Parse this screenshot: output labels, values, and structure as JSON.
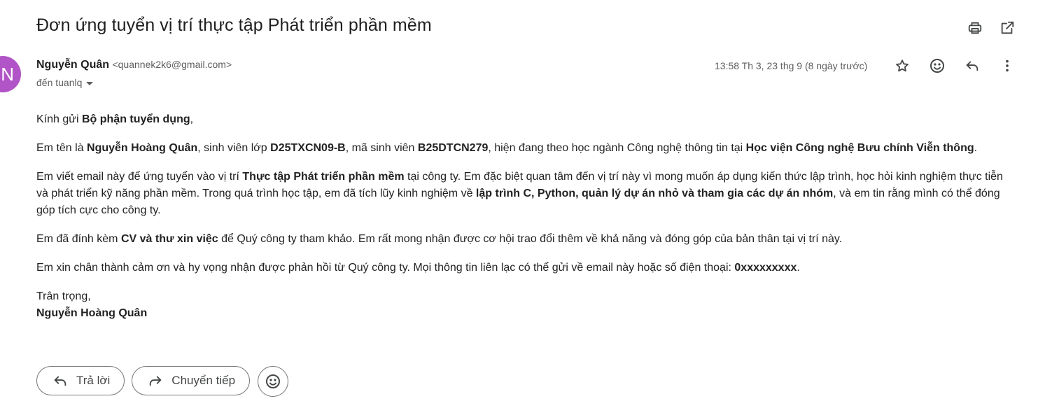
{
  "email": {
    "subject": "Đơn ứng tuyển vị trí thực tập Phát triển phần mềm",
    "sender": {
      "name": "Nguyễn Quân",
      "email": "<quannek2k6@gmail.com>",
      "avatar_letter": "N"
    },
    "recipient": "đến tuanlq",
    "timestamp": "13:58 Th 3, 23 thg 9 (8 ngày trước)",
    "body": {
      "p1": {
        "t1": "Kính gửi ",
        "b1": "Bộ phận tuyển dụng",
        "t2": ","
      },
      "p2": {
        "t1": "Em tên là ",
        "b1": "Nguyễn Hoàng Quân",
        "t2": ", sinh viên lớp ",
        "b2": "D25TXCN09-B",
        "t3": ", mã sinh viên ",
        "b3": "B25DTCN279",
        "t4": ", hiện đang theo học ngành Công nghệ thông tin tại ",
        "b4": "Học viện Công nghệ Bưu chính Viễn thông",
        "t5": "."
      },
      "p3": {
        "t1": "Em viết email này để ứng tuyển vào vị trí ",
        "b1": "Thực tập Phát triển phần mềm",
        "t2": " tại công ty. Em đặc biệt quan tâm đến vị trí này vì mong muốn áp dụng kiến thức lập trình, học hỏi kinh nghiệm thực tiễn và phát triển kỹ năng phần mềm. Trong quá trình học tập, em đã tích lũy kinh nghiệm về ",
        "b2": "lập trình C, Python, quản lý dự án nhỏ và tham gia các dự án nhóm",
        "t3": ", và em tin rằng mình có thể đóng góp tích cực cho công ty."
      },
      "p4": {
        "t1": "Em đã đính kèm ",
        "b1": "CV và thư xin việc",
        "t2": " để Quý công ty tham khảo. Em rất mong nhận được cơ hội trao đổi thêm về khả năng và đóng góp của bản thân tại vị trí này."
      },
      "p5": {
        "t1": "Em xin chân thành cảm ơn và hy vọng nhận được phản hồi từ Quý công ty. Mọi thông tin liên lạc có thể gửi về email này hoặc số điện thoại: ",
        "b1": "0xxxxxxxxx",
        "t2": "."
      },
      "closing": "Trân trọng,",
      "signature": "Nguyễn Hoàng Quân"
    }
  },
  "actions": {
    "reply_label": "Trả lời",
    "forward_label": "Chuyển tiếp"
  },
  "icons": {
    "print": "print-icon",
    "open_new_window": "open-in-new-icon",
    "star": "star-icon",
    "emoji": "emoji-icon",
    "reply": "reply-icon",
    "more": "more-vert-icon",
    "forward": "forward-icon"
  },
  "colors": {
    "avatar": "#b154c7",
    "text": "#1f1f1f",
    "muted": "#5e5e5e",
    "icon": "#444746"
  }
}
